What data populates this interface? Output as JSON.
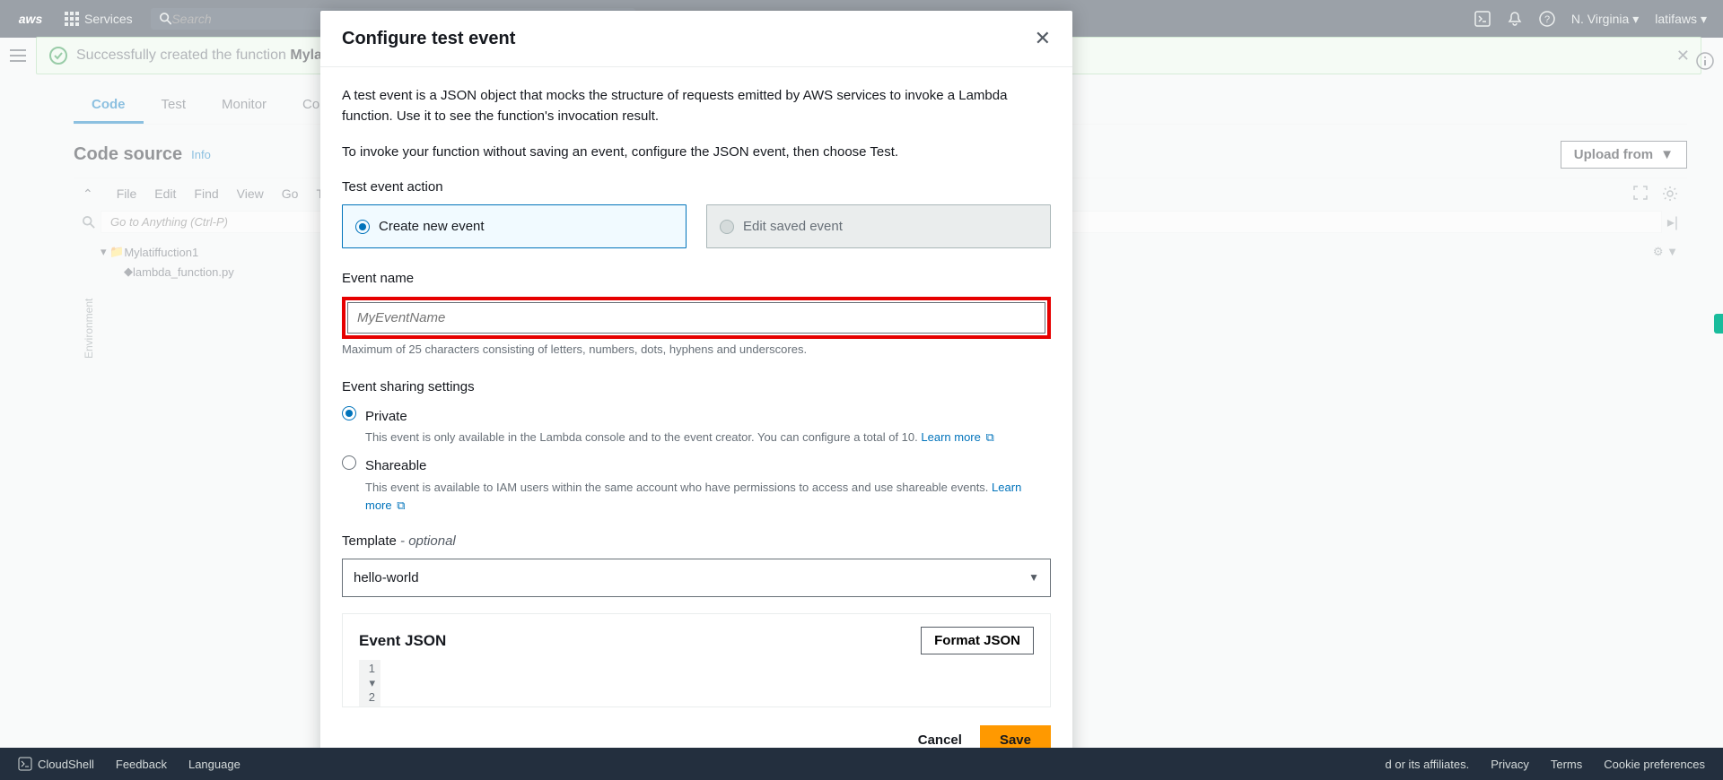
{
  "nav": {
    "logo": "aws",
    "services": "Services",
    "search_placeholder": "Search",
    "region": "N. Virginia",
    "user": "latifaws"
  },
  "banner": {
    "prefix": "Successfully created the function ",
    "name": "Mylatiffu"
  },
  "tabs": [
    "Code",
    "Test",
    "Monitor",
    "Co"
  ],
  "code_source": {
    "title": "Code source",
    "info": "Info",
    "upload": "Upload from"
  },
  "ide_menu": [
    "File",
    "Edit",
    "Find",
    "View",
    "Go",
    "To"
  ],
  "ide_search_placeholder": "Go to Anything (Ctrl-P)",
  "explorer": {
    "root": "Mylatiffuction1",
    "file": "lambda_function.py"
  },
  "env_label": "Environment",
  "modal": {
    "title": "Configure test event",
    "p1": "A test event is a JSON object that mocks the structure of requests emitted by AWS services to invoke a Lambda function. Use it to see the function's invocation result.",
    "p2": "To invoke your function without saving an event, configure the JSON event, then choose Test.",
    "action_label": "Test event action",
    "create": "Create new event",
    "edit": "Edit saved event",
    "event_name_label": "Event name",
    "event_name_placeholder": "MyEventName",
    "event_name_hint": "Maximum of 25 characters consisting of letters, numbers, dots, hyphens and underscores.",
    "sharing_label": "Event sharing settings",
    "private": "Private",
    "private_desc": "This event is only available in the Lambda console and to the event creator. You can configure a total of 10.",
    "shareable": "Shareable",
    "shareable_desc": "This event is available to IAM users within the same account who have permissions to access and use shareable events.",
    "learn_more": "Learn more",
    "template_label": "Template",
    "template_tag": "- optional",
    "template_value": "hello-world",
    "json_header": "Event JSON",
    "format_btn": "Format JSON",
    "cancel": "Cancel",
    "save": "Save"
  },
  "footer": {
    "cloudshell": "CloudShell",
    "feedback": "Feedback",
    "language": "Language",
    "affiliates": "d or its affiliates.",
    "privacy": "Privacy",
    "terms": "Terms",
    "cookies": "Cookie preferences"
  }
}
